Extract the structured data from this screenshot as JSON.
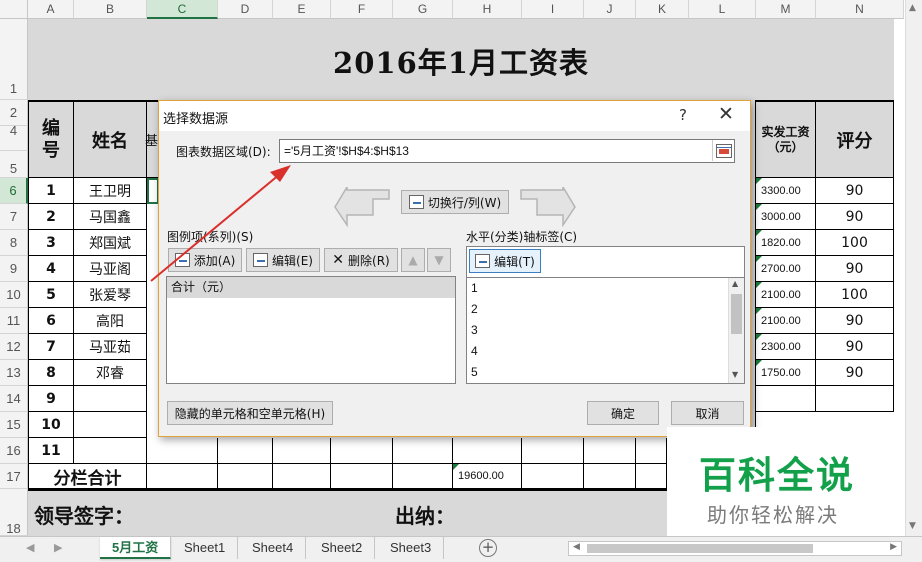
{
  "sheet": {
    "columns": [
      "A",
      "B",
      "C",
      "D",
      "E",
      "F",
      "G",
      "H",
      "I",
      "J",
      "K",
      "L",
      "M",
      "N"
    ],
    "rows": [
      "1",
      "2",
      "4",
      "5",
      "6",
      "7",
      "8",
      "9",
      "10",
      "11",
      "12",
      "13",
      "14",
      "15",
      "16",
      "17",
      "18"
    ],
    "title": "2016年1月工资表",
    "header": {
      "no": "编号",
      "name": "姓名",
      "net_pay": "实发工资\n（元）",
      "score": "评分",
      "partial": "基"
    },
    "data": [
      {
        "no": "1",
        "name": "王卫明",
        "pay": "3300.00",
        "score": "90"
      },
      {
        "no": "2",
        "name": "马国鑫",
        "pay": "3000.00",
        "score": "90"
      },
      {
        "no": "3",
        "name": "郑国斌",
        "pay": "1820.00",
        "score": "100"
      },
      {
        "no": "4",
        "name": "马亚阁",
        "pay": "2700.00",
        "score": "90"
      },
      {
        "no": "5",
        "name": "张爱琴",
        "pay": "2100.00",
        "score": "100"
      },
      {
        "no": "6",
        "name": "高阳",
        "pay": "2100.00",
        "score": "90"
      },
      {
        "no": "7",
        "name": "马亚茹",
        "pay": "2300.00",
        "score": "90"
      },
      {
        "no": "8",
        "name": "邓睿",
        "pay": "1750.00",
        "score": "90"
      }
    ],
    "empty_nos": [
      "9",
      "10",
      "11"
    ],
    "subtotal_label": "分栏合计",
    "subtotal_value": "19600.00",
    "sign_leader": "领导签字：",
    "sign_cashier": "出纳："
  },
  "tabs": [
    "5月工资",
    "Sheet1",
    "Sheet4",
    "Sheet2",
    "Sheet3"
  ],
  "add_sheet": "⊕",
  "dialog": {
    "title": "选择数据源",
    "help": "?",
    "close": "✕",
    "range_label": "图表数据区域(D):",
    "range_value": "='5月工资'!$H$4:$H$13",
    "switch_label": "切换行/列(W)",
    "legend_label": "图例项(系列)(S)",
    "add_label": "添加(A)",
    "edit_label": "编辑(E)",
    "delete_label": "删除(R)",
    "series": [
      "合计（元）"
    ],
    "axis_label": "水平(分类)轴标签(C)",
    "axis_edit_label": "编辑(T)",
    "axis_items": [
      "1",
      "2",
      "3",
      "4",
      "5"
    ],
    "hidden_cells_label": "隐藏的单元格和空单元格(H)",
    "ok_label": "确定",
    "cancel_label": "取消"
  },
  "watermark": {
    "brand": "百科全说",
    "slogan": "助你轻松解决"
  },
  "colors": {
    "excel_green": "#217346",
    "arrow_red": "#d9302c",
    "watermark_green": "#13a04b"
  }
}
